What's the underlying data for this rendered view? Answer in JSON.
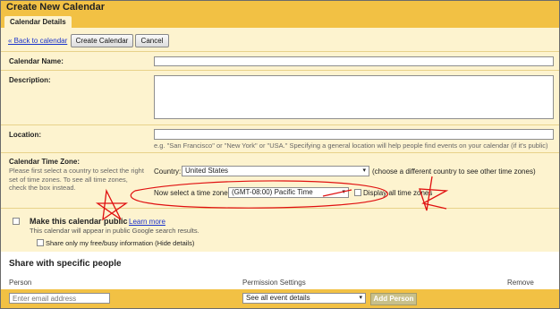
{
  "window": {
    "title": "Create New Calendar"
  },
  "tabs": [
    {
      "label": "Calendar Details"
    }
  ],
  "toolbar": {
    "back_link": "« Back to calendar",
    "create_button": "Create Calendar",
    "cancel_button": "Cancel"
  },
  "form": {
    "name": {
      "label": "Calendar Name:",
      "value": ""
    },
    "description": {
      "label": "Description:",
      "value": ""
    },
    "location": {
      "label": "Location:",
      "value": "",
      "hint": "e.g. \"San Francisco\" or \"New York\" or \"USA.\" Specifying a general location will help people find events on your calendar (if it's public)"
    },
    "timezone": {
      "label": "Calendar Time Zone:",
      "help_lines": [
        "Please first select a country to select the right",
        "set of time zones. To see all time zones,",
        "check the box instead."
      ],
      "country_label": "Country:",
      "country_value": "United States",
      "country_note": "(choose a different country to see other time zones)",
      "tz_label": "Now select a time zone:",
      "tz_value": "(GMT-08:00) Pacific Time",
      "display_all": "Display all time zones"
    },
    "public": {
      "label": "Make this calendar public",
      "learn_more": "Learn more",
      "note": "This calendar will appear in public Google search results.",
      "freebusy": "Share only my free/busy information (Hide details)"
    }
  },
  "share": {
    "title": "Share with specific people",
    "columns": {
      "person": "Person",
      "permission": "Permission Settings",
      "remove": "Remove"
    },
    "email_placeholder": "Enter email address",
    "permission_value": "See all event details",
    "add_button": "Add Person"
  },
  "colors": {
    "header": "#f2c144",
    "panel": "#fdf3cf",
    "annotation": "#e01010"
  }
}
